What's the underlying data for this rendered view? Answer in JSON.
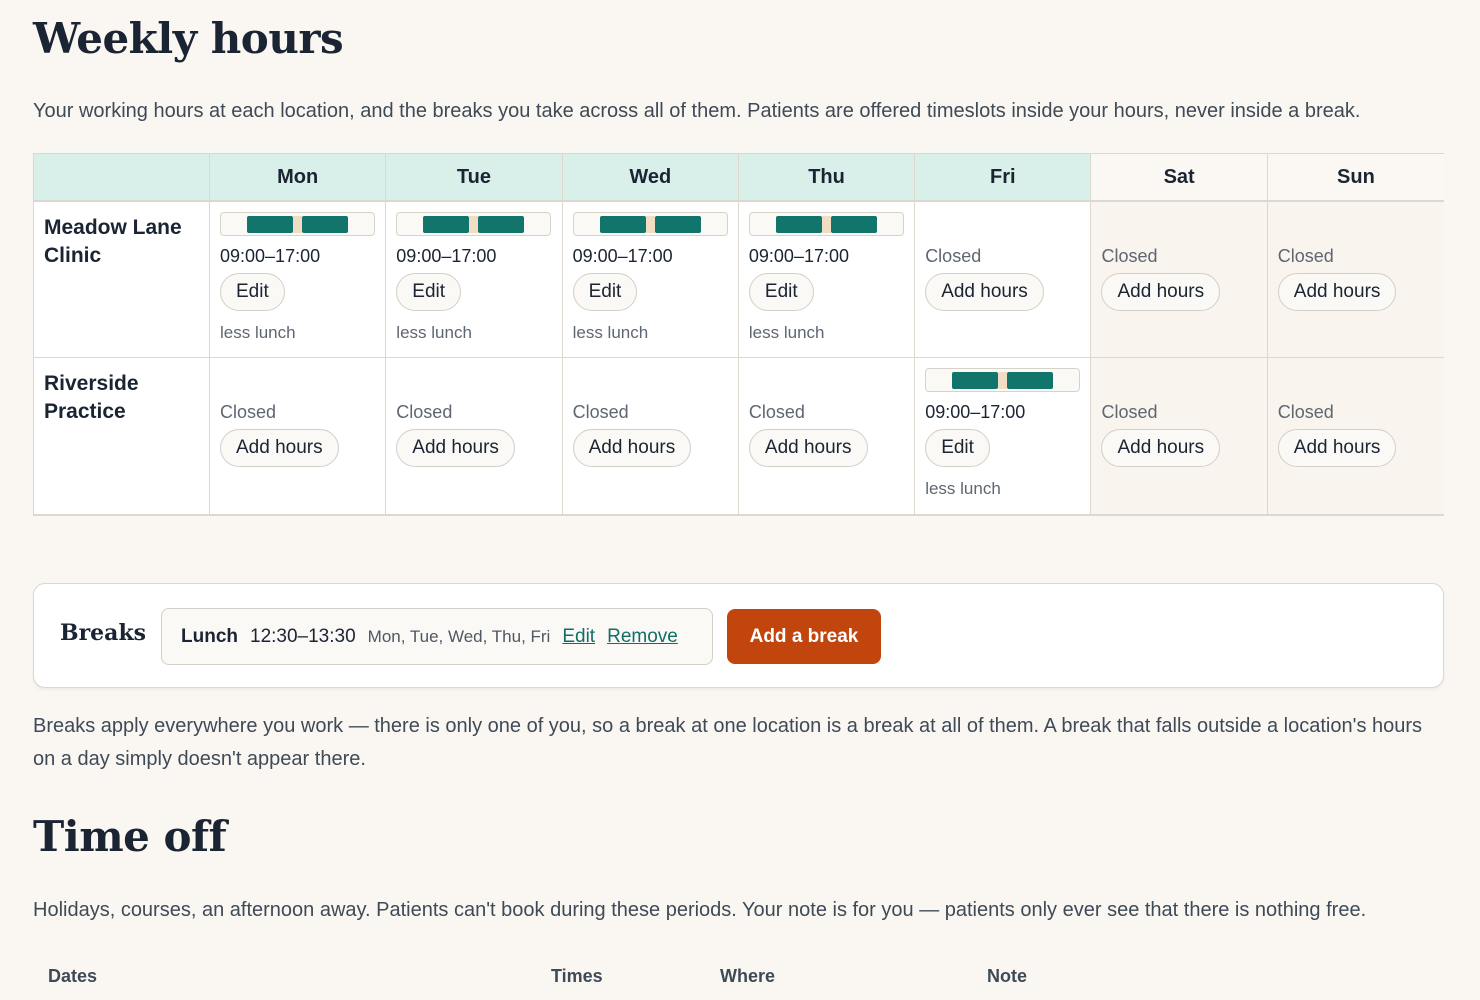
{
  "weekly": {
    "title": "Weekly hours",
    "intro": "Your working hours at each location, and the breaks you take across all of them. Patients are offered timeslots inside your hours, never inside a break."
  },
  "days": [
    "Mon",
    "Tue",
    "Wed",
    "Thu",
    "Fri",
    "Sat",
    "Sun"
  ],
  "locations": [
    {
      "name": "Meadow Lane Clinic",
      "cells": [
        {
          "hours": "09:00–17:00",
          "button": "Edit",
          "note": "less lunch"
        },
        {
          "hours": "09:00–17:00",
          "button": "Edit",
          "note": "less lunch"
        },
        {
          "hours": "09:00–17:00",
          "button": "Edit",
          "note": "less lunch"
        },
        {
          "hours": "09:00–17:00",
          "button": "Edit",
          "note": "less lunch"
        },
        {
          "status": "Closed",
          "button": "Add hours"
        },
        {
          "status": "Closed",
          "button": "Add hours"
        },
        {
          "status": "Closed",
          "button": "Add hours"
        }
      ]
    },
    {
      "name": "Riverside Practice",
      "cells": [
        {
          "status": "Closed",
          "button": "Add hours"
        },
        {
          "status": "Closed",
          "button": "Add hours"
        },
        {
          "status": "Closed",
          "button": "Add hours"
        },
        {
          "status": "Closed",
          "button": "Add hours"
        },
        {
          "hours": "09:00–17:00",
          "button": "Edit",
          "note": "less lunch"
        },
        {
          "status": "Closed",
          "button": "Add hours"
        },
        {
          "status": "Closed",
          "button": "Add hours"
        }
      ]
    }
  ],
  "breaks": {
    "label": "Breaks",
    "items": [
      {
        "name": "Lunch",
        "time": "12:30–13:30",
        "days": "Mon, Tue, Wed, Thu, Fri",
        "edit": "Edit",
        "remove": "Remove"
      }
    ],
    "add_label": "Add a break",
    "note": "Breaks apply everywhere you work — there is only one of you, so a break at one location is a break at all of them. A break that falls outside a location's hours on a day simply doesn't appear there."
  },
  "timeoff": {
    "title": "Time off",
    "intro": "Holidays, courses, an afternoon away. Patients can't book during these periods. Your note is for you — patients only ever see that there is nothing free.",
    "columns": [
      "Dates",
      "Times",
      "Where",
      "Note"
    ]
  },
  "colors": {
    "accent": "#12756b",
    "primary_button": "#c2450d",
    "weekday_header": "#d9efea",
    "break_marker": "#f1dcc4"
  }
}
